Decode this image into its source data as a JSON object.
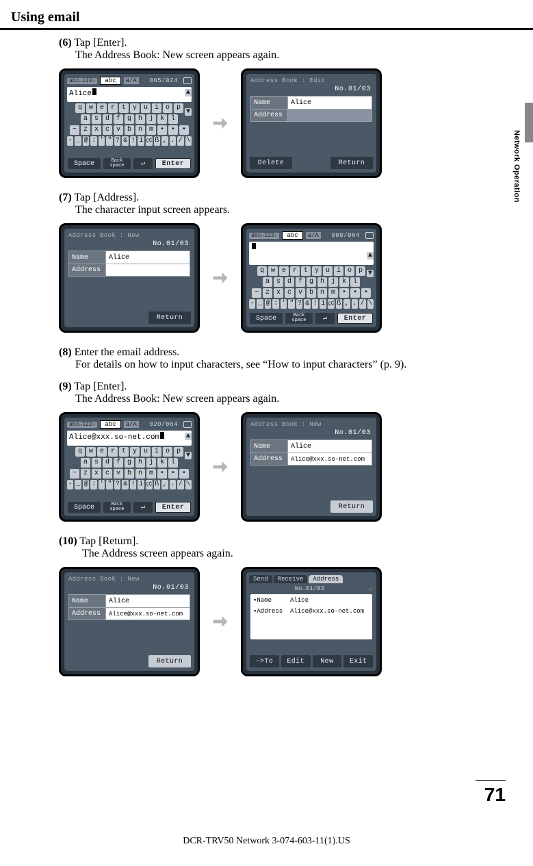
{
  "header": {
    "title": "Using email"
  },
  "section_tab": "Network Operation",
  "steps": {
    "s6": {
      "num": "(6)",
      "line1": "Tap [Enter].",
      "line2": "The Address Book: New screen appears again."
    },
    "s7": {
      "num": "(7)",
      "line1": "Tap [Address].",
      "line2": "The character input screen appears."
    },
    "s8": {
      "num": "(8)",
      "line1": "Enter the email address.",
      "line2": "For details on how to input characters, see “How to input characters” (p. 9)."
    },
    "s9": {
      "num": "(9)",
      "line1": "Tap [Enter].",
      "line2": "The Address Book: New screen appears again."
    },
    "s10": {
      "num": "(10)",
      "line1": "Tap [Return].",
      "line2": "The Address screen appears again."
    }
  },
  "kb": {
    "mode_tag": "abc↔123›",
    "mode_abc": "abc",
    "mode_case": "a/A",
    "row1": [
      "q",
      "w",
      "e",
      "r",
      "t",
      "y",
      "u",
      "i",
      "o",
      "p"
    ],
    "row2": [
      "a",
      "s",
      "d",
      "f",
      "g",
      "h",
      "j",
      "k",
      "l"
    ],
    "row3": [
      "~",
      "z",
      "x",
      "c",
      "v",
      "b",
      "n",
      "m",
      "•",
      "•",
      "•"
    ],
    "row4": [
      "-",
      "_",
      "@",
      ":",
      "'",
      "\"",
      "?",
      "&",
      "!",
      "i",
      "çÇ",
      "ß",
      ",",
      ".",
      "/",
      "\\"
    ],
    "space": "Space",
    "backspace": "Back\nspace",
    "enter": "Enter",
    "counters": {
      "c1": "005/024",
      "c2": "000/064",
      "c3": "020/064"
    },
    "texts": {
      "t1": "Alice",
      "t2": "",
      "t3": "Alice@xxx.so-net.com"
    }
  },
  "ab": {
    "title_edit": "Address Book : Edit",
    "title_new": "Address Book : New",
    "no": "No.01/03",
    "name_label": "Name",
    "address_label": "Address",
    "name_val": "Alice",
    "address_val_empty": "",
    "address_val": "Alice@xxx.so-net.com",
    "delete": "Delete",
    "return": "Return"
  },
  "tabbed": {
    "send": "Send",
    "receive": "Receive",
    "address": "Address",
    "no": "No.01/03",
    "row_name_label": "▪Name",
    "row_name_val": "Alice",
    "row_addr_label": "▪Address",
    "row_addr_val": "Alice@xxx.so-net.com",
    "to": "->To",
    "edit": "Edit",
    "new": "New",
    "exit": "Exit"
  },
  "page_number": "71",
  "footer": "DCR-TRV50 Network 3-074-603-11(1).US"
}
